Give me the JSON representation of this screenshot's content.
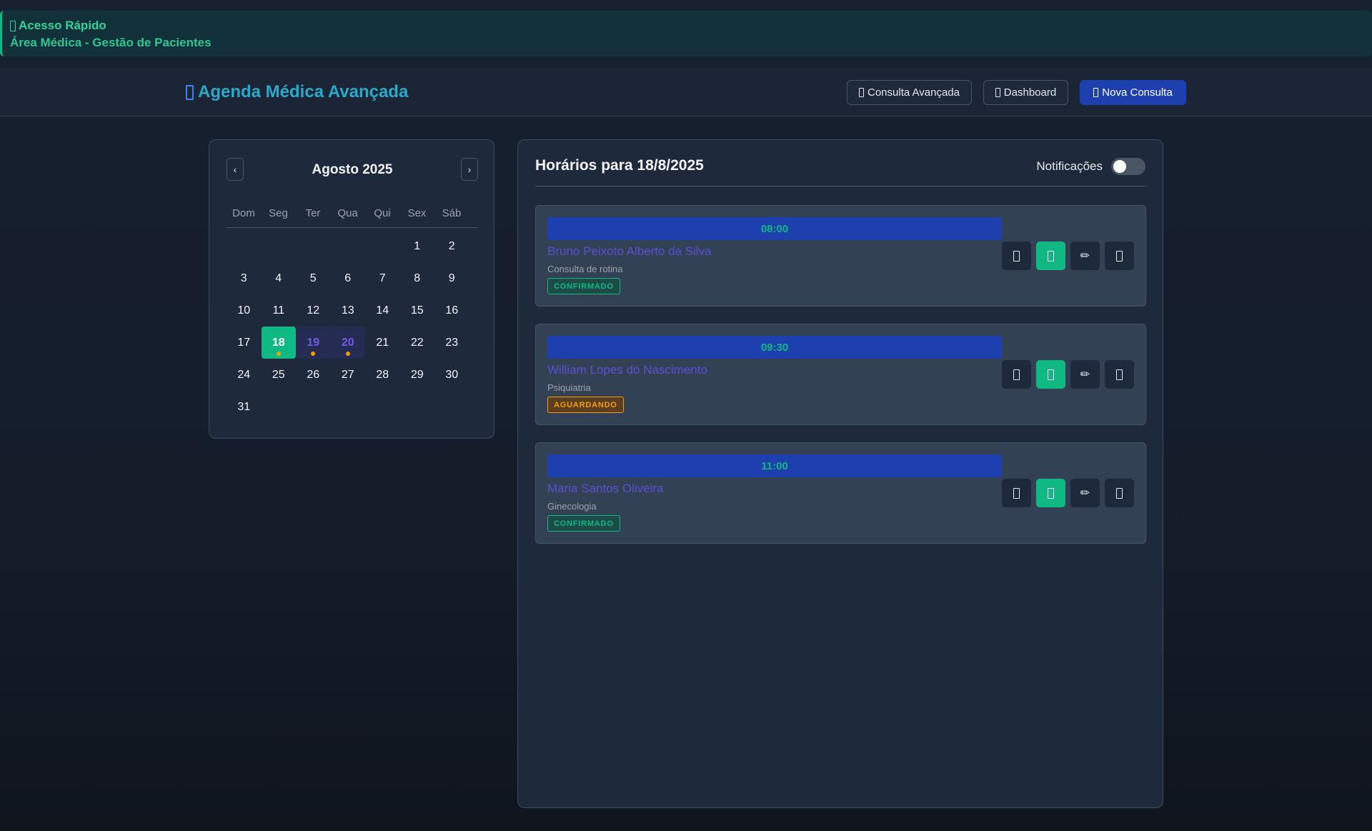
{
  "quick_access": {
    "title": "Acesso Rápido",
    "subtitle": "Área Médica - Gestão de Pacientes"
  },
  "header": {
    "brand": "Agenda Médica Avançada",
    "buttons": {
      "advanced": "Consulta Avançada",
      "dashboard": "Dashboard",
      "new": "Nova Consulta"
    }
  },
  "calendar": {
    "month_label": "Agosto 2025",
    "prev": "‹",
    "next": "›",
    "weekdays": [
      "Dom",
      "Seg",
      "Ter",
      "Qua",
      "Qui",
      "Sex",
      "Sáb"
    ],
    "leading_blanks": 5,
    "days_in_month": 31,
    "selected_day": 18,
    "days_with_appointments": [
      18,
      19,
      20
    ]
  },
  "schedule": {
    "title": "Horários para 18/8/2025",
    "notifications_label": "Notificações",
    "notifications_on": false,
    "appointments": [
      {
        "time": "08:00",
        "patient": "Bruno Peixoto Alberto da Silva",
        "type": "Consulta de rotina",
        "status": "CONFIRMADO",
        "status_key": "confirmado"
      },
      {
        "time": "09:30",
        "patient": "William Lopes do Nascimento",
        "type": "Psiquiatria",
        "status": "AGUARDANDO",
        "status_key": "aguardando"
      },
      {
        "time": "11:00",
        "patient": "Maria Santos Oliveira",
        "type": "Ginecologia",
        "status": "CONFIRMADO",
        "status_key": "confirmado"
      }
    ],
    "action_icons": [
      "phone-icon",
      "whatsapp-icon",
      "edit-icon",
      "delete-icon"
    ],
    "edit_glyph": "✏"
  },
  "colors": {
    "accent_green": "#10b981",
    "primary_blue": "#1e40af",
    "patient_name": "#5b4fd6",
    "waiting_amber": "#f59e0b"
  }
}
